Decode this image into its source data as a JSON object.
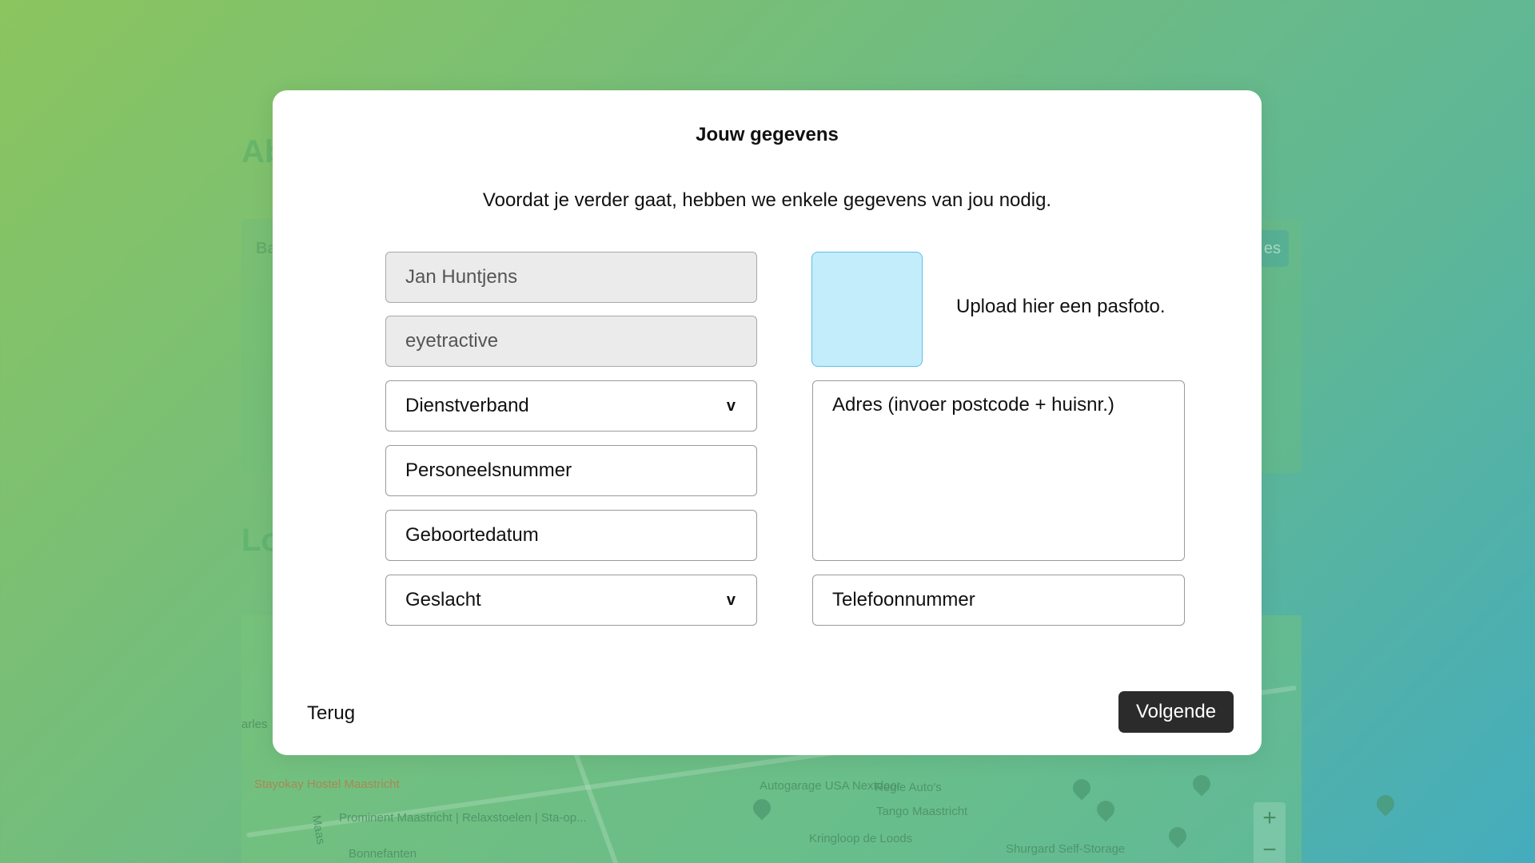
{
  "background": {
    "heading_1": "Ab",
    "heading_2": "Lo",
    "card_label": "Ba",
    "pill_label": "es",
    "map_labels": [
      "Stayokay Hostel Maastricht",
      "Prominent Maastricht | Relaxstoelen | Sta-op...",
      "Autogarage USA Nextdoor",
      "Regie Auto's",
      "Tango Maastricht",
      "Kringloop de Loods",
      "Shurgard Self-Storage",
      "Bonnefanten",
      "Maas",
      "arles"
    ],
    "zoom_in": "+",
    "zoom_out": "−"
  },
  "modal": {
    "title": "Jouw gegevens",
    "subtitle": "Voordat je verder gaat, hebben we enkele gegevens van jou nodig.",
    "fields": {
      "name": "Jan Huntjens",
      "company": "eyetractive",
      "employment": "Dienstverband",
      "employee_number": "Personeelsnummer",
      "birth_date": "Geboortedatum",
      "gender": "Geslacht",
      "address": "Adres (invoer postcode + huisnr.)",
      "phone": "Telefoonnummer"
    },
    "select_indicator": "v",
    "photo_label": "Upload hier een pasfoto.",
    "back_label": "Terug",
    "next_label": "Volgende"
  }
}
